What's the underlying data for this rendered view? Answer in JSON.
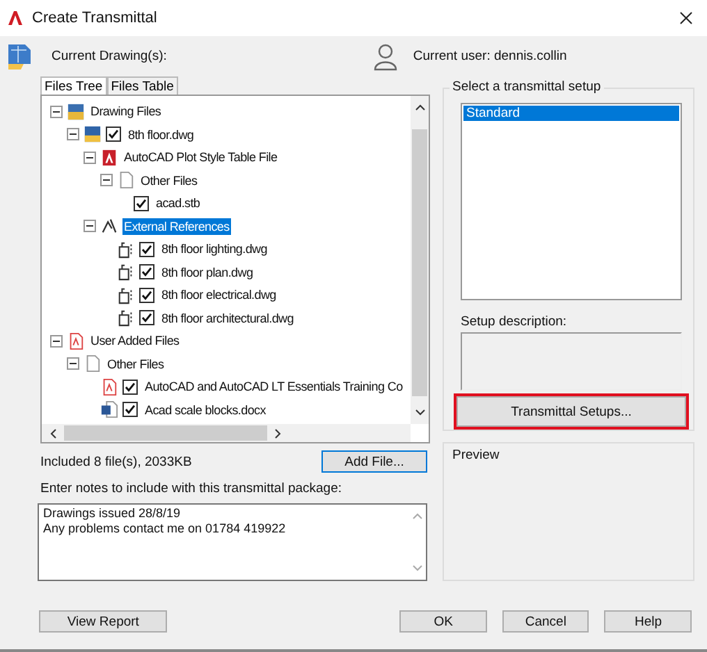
{
  "window": {
    "title": "Create Transmittal"
  },
  "current_drawings_label": "Current Drawing(s):",
  "current_user": "Current user: dennis.collin",
  "tabs": [
    {
      "label": "Files Tree",
      "selected": true
    },
    {
      "label": "Files Table",
      "selected": false
    }
  ],
  "tree": [
    {
      "label": "Drawing Files",
      "kind": "drawing-set",
      "expanded": true,
      "selected": false,
      "children": [
        {
          "label": "8th floor.dwg",
          "kind": "dwg",
          "expanded": true,
          "checked": true,
          "selected": false,
          "children": [
            {
              "label": "AutoCAD Plot Style Table File",
              "kind": "plot-style",
              "expanded": true,
              "selected": false,
              "children": [
                {
                  "label": "Other Files",
                  "kind": "file",
                  "expanded": true,
                  "selected": false,
                  "children": [
                    {
                      "label": "acad.stb",
                      "checked": true,
                      "selected": false
                    }
                  ]
                }
              ]
            },
            {
              "label": "External References",
              "kind": "xref-group",
              "expanded": true,
              "selected": true,
              "children": [
                {
                  "label": "8th floor lighting.dwg",
                  "kind": "xref",
                  "checked": true,
                  "selected": false
                },
                {
                  "label": "8th floor plan.dwg",
                  "kind": "xref",
                  "checked": true,
                  "selected": false
                },
                {
                  "label": "8th floor electrical.dwg",
                  "kind": "xref",
                  "checked": true,
                  "selected": false
                },
                {
                  "label": "8th floor architectural.dwg",
                  "kind": "xref",
                  "checked": true,
                  "selected": false
                }
              ]
            }
          ]
        }
      ]
    },
    {
      "label": "User Added Files",
      "kind": "pdf",
      "expanded": true,
      "selected": false,
      "children": [
        {
          "label": "Other Files",
          "kind": "file",
          "expanded": true,
          "selected": false,
          "children": [
            {
              "label": "AutoCAD and AutoCAD LT Essentials Training Co",
              "kind": "pdf",
              "checked": true,
              "selected": false
            },
            {
              "label": "Acad scale blocks.docx",
              "kind": "word",
              "checked": true,
              "selected": false
            }
          ]
        }
      ]
    }
  ],
  "files_summary": "Included 8 file(s), 2033KB",
  "add_file_button": "Add File...",
  "notes_label": "Enter notes to include with this transmittal package:",
  "notes": {
    "value": "Drawings issued 28/8/19\nAny problems contact me on 01784 419922"
  },
  "setup_group": {
    "title": "Select a transmittal setup",
    "items": [
      {
        "label": "Standard",
        "selected": true
      }
    ]
  },
  "setup_description_label": "Setup description:",
  "setups_button": {
    "label": "Transmittal Setups...",
    "highlighted": true
  },
  "preview": {
    "title": "Preview"
  },
  "buttons": [
    {
      "label": "View Report"
    },
    {
      "label": "OK"
    },
    {
      "label": "Cancel"
    },
    {
      "label": "Help"
    }
  ]
}
